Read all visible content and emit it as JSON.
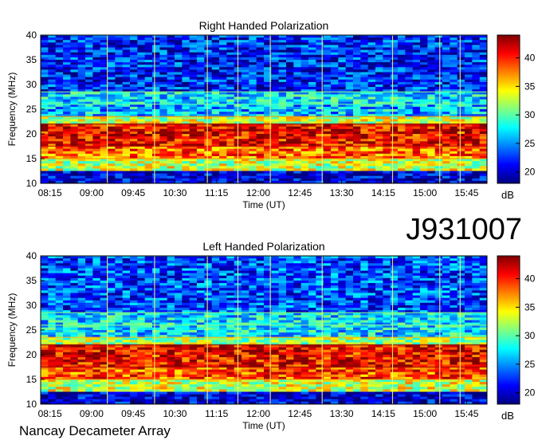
{
  "figure": {
    "observation_id": "J931007",
    "footer": "Nancay Decameter Array"
  },
  "colors": {
    "stops": [
      "#00007f",
      "#0000ff",
      "#0080ff",
      "#00ffff",
      "#80ff80",
      "#ffff00",
      "#ff8000",
      "#ff0000",
      "#7f0000"
    ]
  },
  "chart_data": [
    {
      "type": "heatmap",
      "title": "Right Handed Polarization",
      "xlabel": "Time (UT)",
      "ylabel": "Frequency (MHz)",
      "xlim": [
        "08:05",
        "16:07"
      ],
      "ylim": [
        10,
        40
      ],
      "xticks": [
        "08:15",
        "09:00",
        "09:45",
        "10:30",
        "11:15",
        "12:00",
        "12:45",
        "13:30",
        "14:15",
        "15:00",
        "15:45"
      ],
      "yticks": [
        10,
        15,
        20,
        25,
        30,
        35,
        40
      ],
      "colorbar": {
        "label": "dB",
        "ticks": [
          20,
          25,
          30,
          35,
          40
        ],
        "range": [
          18,
          44
        ]
      },
      "bands": [
        {
          "freq": [
            12.5,
            15.0
          ],
          "level": 33
        },
        {
          "freq": [
            15.0,
            17.5
          ],
          "level": 38
        },
        {
          "freq": [
            17.5,
            22.0
          ],
          "level": 41
        },
        {
          "freq": [
            22.0,
            23.5
          ],
          "level": 33
        },
        {
          "freq": [
            23.5,
            26.0
          ],
          "level": 26
        },
        {
          "freq": [
            26.0,
            28.5
          ],
          "level": 27
        },
        {
          "freq": [
            28.5,
            40.0
          ],
          "level": 22
        }
      ],
      "vertical_lines": [
        "09:17",
        "10:08",
        "11:05",
        "11:38",
        "12:13",
        "13:09",
        "14:25",
        "15:16",
        "15:38"
      ]
    },
    {
      "type": "heatmap",
      "title": "Left Handed Polarization",
      "xlabel": "Time (UT)",
      "ylabel": "Frequency (MHz)",
      "xlim": [
        "08:05",
        "16:07"
      ],
      "ylim": [
        10,
        40
      ],
      "xticks": [
        "08:15",
        "09:00",
        "09:45",
        "10:30",
        "11:15",
        "12:00",
        "12:45",
        "13:30",
        "14:15",
        "15:00",
        "15:45"
      ],
      "yticks": [
        10,
        15,
        20,
        25,
        30,
        35,
        40
      ],
      "colorbar": {
        "label": "dB",
        "ticks": [
          20,
          25,
          30,
          35,
          40
        ],
        "range": [
          18,
          44
        ]
      },
      "bands": [
        {
          "freq": [
            12.5,
            15.0
          ],
          "level": 33
        },
        {
          "freq": [
            15.0,
            17.5
          ],
          "level": 39
        },
        {
          "freq": [
            17.5,
            22.0
          ],
          "level": 41
        },
        {
          "freq": [
            22.0,
            23.5
          ],
          "level": 32
        },
        {
          "freq": [
            23.5,
            26.0
          ],
          "level": 27
        },
        {
          "freq": [
            26.0,
            28.5
          ],
          "level": 27
        },
        {
          "freq": [
            28.5,
            40.0
          ],
          "level": 23
        }
      ],
      "vertical_lines": [
        "09:17",
        "10:08",
        "11:05",
        "11:38",
        "12:13",
        "13:09",
        "14:25",
        "15:16",
        "15:38"
      ]
    }
  ]
}
